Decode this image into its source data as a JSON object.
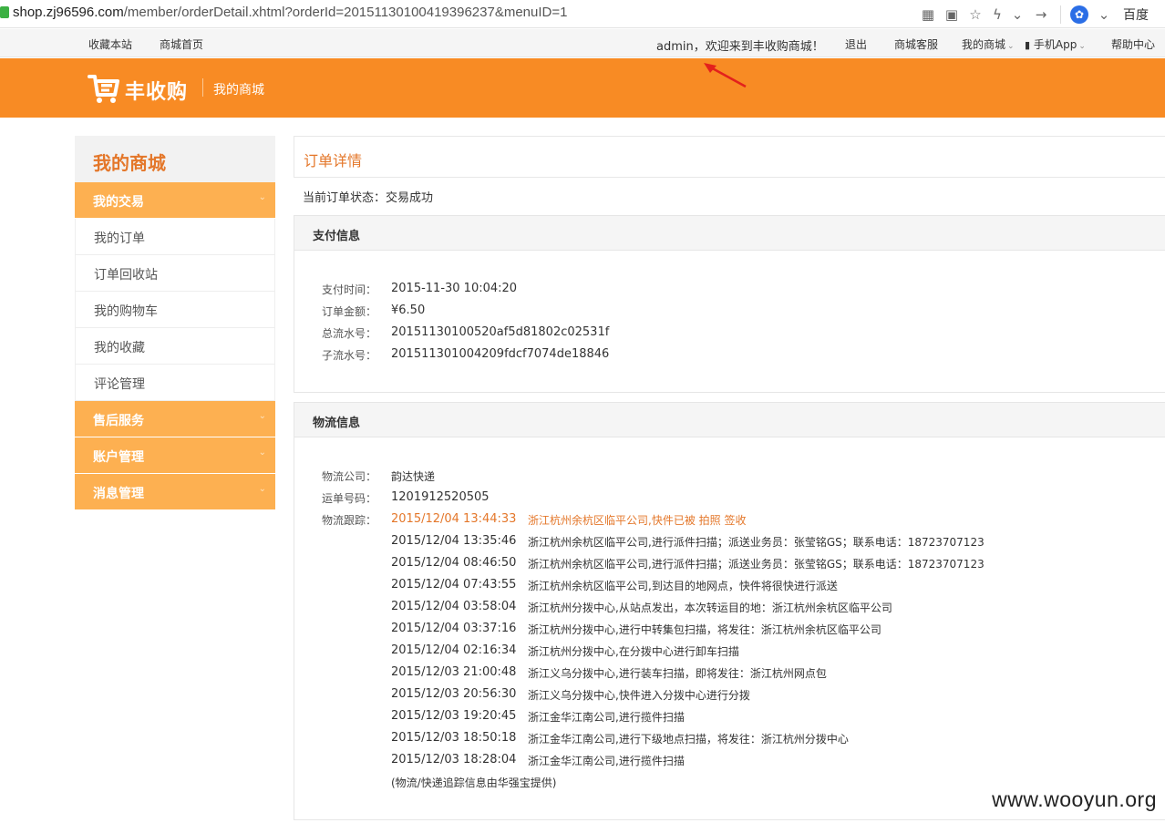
{
  "browser": {
    "url_host": "shop.zj96596.com",
    "url_path": "/member/orderDetail.xhtml?orderId=20151130100419396237&menuID=1",
    "search_engine_label": "百度"
  },
  "topnav": {
    "favorite": "收藏本站",
    "home": "商城首页",
    "welcome": "admin，欢迎来到丰收购商城！",
    "logout": "退出",
    "service": "商城客服",
    "my_mall": "我的商城",
    "app": "手机App",
    "help": "帮助中心"
  },
  "header": {
    "logo_text": "丰收购",
    "subtitle": "我的商城"
  },
  "sidebar": {
    "title": "我的商城",
    "groups": [
      {
        "label": "我的交易",
        "items": [
          "我的订单",
          "订单回收站",
          "我的购物车",
          "我的收藏",
          "评论管理"
        ]
      },
      {
        "label": "售后服务"
      },
      {
        "label": "账户管理"
      },
      {
        "label": "消息管理"
      }
    ]
  },
  "main": {
    "page_title": "订单详情",
    "status": "当前订单状态：交易成功",
    "payment": {
      "heading": "支付信息",
      "rows": [
        {
          "label": "支付时间：",
          "value": "2015-11-30 10:04:20"
        },
        {
          "label": "订单金额：",
          "value": "¥6.50"
        },
        {
          "label": "总流水号：",
          "value": "20151130100520af5d81802c02531f"
        },
        {
          "label": "子流水号：",
          "value": "201511301004209fdcf7074de18846"
        }
      ]
    },
    "logistics": {
      "heading": "物流信息",
      "company_label": "物流公司：",
      "company": "韵达快递",
      "tracking_no_label": "运单号码：",
      "tracking_no": "1201912520505",
      "track_label": "物流跟踪：",
      "tracks": [
        {
          "time": "2015/12/04 13:44:33",
          "desc": "浙江杭州余杭区临平公司,快件已被 拍照 签收"
        },
        {
          "time": "2015/12/04 13:35:46",
          "desc": "浙江杭州余杭区临平公司,进行派件扫描；派送业务员：张莹铭GS；联系电话：18723707123"
        },
        {
          "time": "2015/12/04 08:46:50",
          "desc": "浙江杭州余杭区临平公司,进行派件扫描；派送业务员：张莹铭GS；联系电话：18723707123"
        },
        {
          "time": "2015/12/04 07:43:55",
          "desc": "浙江杭州余杭区临平公司,到达目的地网点，快件将很快进行派送"
        },
        {
          "time": "2015/12/04 03:58:04",
          "desc": "浙江杭州分拨中心,从站点发出，本次转运目的地：浙江杭州余杭区临平公司"
        },
        {
          "time": "2015/12/04 03:37:16",
          "desc": "浙江杭州分拨中心,进行中转集包扫描，将发往：浙江杭州余杭区临平公司"
        },
        {
          "time": "2015/12/04 02:16:34",
          "desc": "浙江杭州分拨中心,在分拨中心进行卸车扫描"
        },
        {
          "time": "2015/12/03 21:00:48",
          "desc": "浙江义乌分拨中心,进行装车扫描，即将发往：浙江杭州网点包"
        },
        {
          "time": "2015/12/03 20:56:30",
          "desc": "浙江义乌分拨中心,快件进入分拨中心进行分拨"
        },
        {
          "time": "2015/12/03 19:20:45",
          "desc": "浙江金华江南公司,进行揽件扫描"
        },
        {
          "time": "2015/12/03 18:50:18",
          "desc": "浙江金华江南公司,进行下级地点扫描，将发往：浙江杭州分拨中心"
        },
        {
          "time": "2015/12/03 18:28:04",
          "desc": "浙江金华江南公司,进行揽件扫描"
        }
      ],
      "footnote": "(物流/快递追踪信息由华强宝提供)"
    }
  },
  "watermark": "www.wooyun.org",
  "colors": {
    "brand_orange": "#f88b24",
    "sidebar_orange": "#fdb051",
    "accent": "#e4772a"
  }
}
